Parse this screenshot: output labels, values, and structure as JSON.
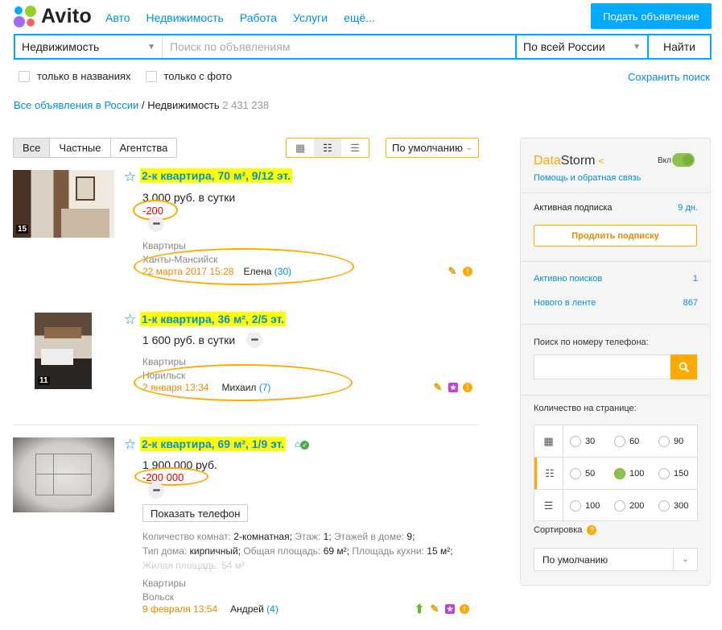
{
  "header": {
    "logo": "Avito",
    "nav": [
      "Авто",
      "Недвижимость",
      "Работа",
      "Услуги",
      "ещё..."
    ],
    "post_button": "Подать объявление"
  },
  "search": {
    "category": "Недвижимость",
    "placeholder": "Поиск по объявлениям",
    "region": "По всей России",
    "submit": "Найти",
    "filter_titles": "только в названиях",
    "filter_photo": "только с фото",
    "save": "Сохранить поиск"
  },
  "breadcrumb": {
    "root": "Все объявления в России",
    "sep": "/",
    "current": "Недвижимость",
    "count": "2 431 238"
  },
  "controls": {
    "segments": [
      "Все",
      "Частные",
      "Агентства"
    ],
    "sort": "По умолчанию"
  },
  "listings": [
    {
      "photos": "15",
      "title": "2-к квартира, 70 м², 9/12 эт.",
      "price": "3 000 руб. в сутки",
      "discount": "-200",
      "category": "Квартиры",
      "city": "Ханты-Мансийск",
      "date": "22 марта 2017 15:28",
      "seller": "Елена",
      "seller_count": "(30)"
    },
    {
      "photos": "11",
      "title": "1-к квартира, 36 м², 2/5 эт.",
      "price": "1 600 руб. в сутки",
      "category": "Квартиры",
      "city": "Норильск",
      "date": "2 января 13:34",
      "seller": "Михаил",
      "seller_count": "(7)"
    },
    {
      "title": "2-к квартира, 69 м², 1/9 эт.",
      "price": "1 900 000 руб.",
      "discount": "-200 000",
      "show_phone": "Показать телефон",
      "params": {
        "rooms_label": "Количество комнат:",
        "rooms": "2-комнатная;",
        "floor_label": "Этаж:",
        "floor": "1;",
        "floors_label": "Этажей в доме:",
        "floors": "9;",
        "type_label": "Тип дома:",
        "type": "кирпичный;",
        "area_label": "Общая площадь:",
        "area": "69 м²;",
        "kitchen_label": "Площадь кухни:",
        "kitchen": "15 м²;",
        "living": "Жилая площадь: 54 м²"
      },
      "category": "Квартиры",
      "city": "Вольск",
      "date": "9 февраля 13:54",
      "seller": "Андрей",
      "seller_count": "(4)"
    }
  ],
  "sidebar": {
    "brand_a": "Data",
    "brand_b": "Storm",
    "toggle": "Вкл",
    "help": "Помощь и обратная связь",
    "sub_label": "Активная подписка",
    "sub_value": "9 дн.",
    "extend": "Продлить подписку",
    "active_label": "Активно поисков",
    "active_value": "1",
    "new_label": "Нового в ленте",
    "new_value": "867",
    "phone_label": "Поиск по номеру телефона:",
    "per_page_label": "Количество на странице:",
    "per_page": [
      [
        "30",
        "60",
        "90"
      ],
      [
        "50",
        "100",
        "150"
      ],
      [
        "100",
        "200",
        "300"
      ]
    ],
    "sort_label": "Сортировка",
    "sort_value": "По умолчанию"
  },
  "colors": {
    "accent": "#00aaff",
    "link": "#0091d9",
    "orange": "#ffa800",
    "highlight": "#ffff00",
    "discount": "#e30000"
  }
}
